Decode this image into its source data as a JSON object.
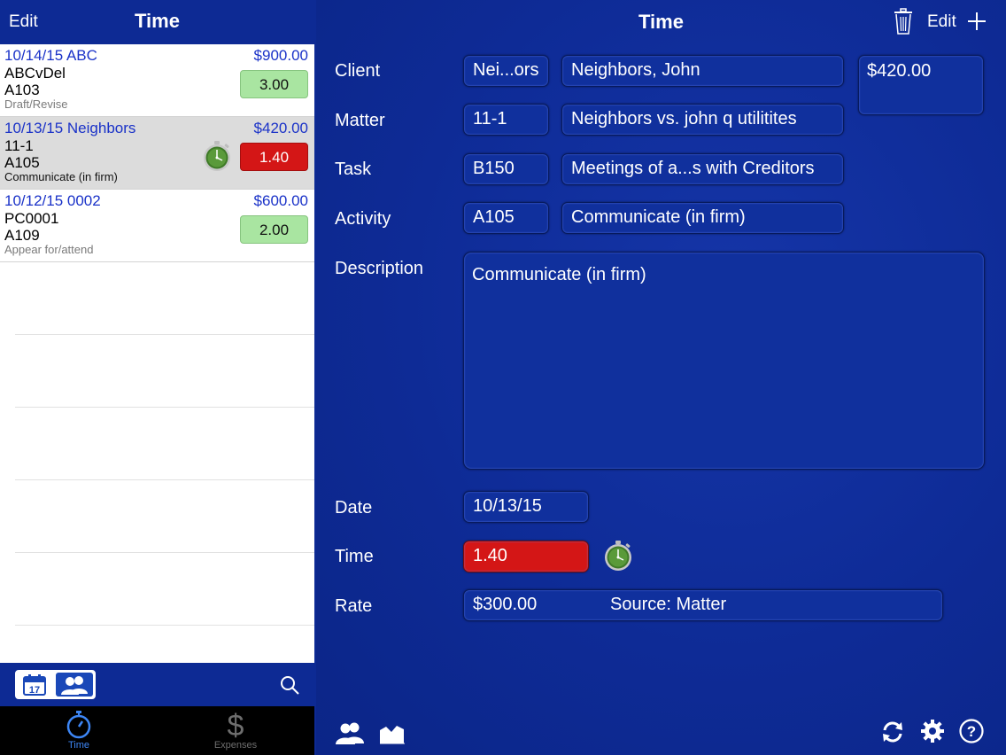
{
  "left": {
    "nav": {
      "edit": "Edit",
      "title": "Time"
    },
    "entries": [
      {
        "date_client": "10/14/15  ABC",
        "amount": "$900.00",
        "matter": "ABCvDel",
        "code": "A103",
        "activity": "Draft/Revise",
        "hours": "3.00",
        "status": "green",
        "selected": false,
        "timer": false
      },
      {
        "date_client": "10/13/15  Neighbors",
        "amount": "$420.00",
        "matter": "11-1",
        "code": "A105",
        "activity": "Communicate (in firm)",
        "hours": "1.40",
        "status": "red",
        "selected": true,
        "timer": true
      },
      {
        "date_client": "10/12/15  0002",
        "amount": "$600.00",
        "matter": "PC0001",
        "code": "A109",
        "activity": "Appear for/attend",
        "hours": "2.00",
        "status": "green",
        "selected": false,
        "timer": false
      }
    ],
    "toolbar": {
      "calendar_day": "17"
    },
    "tabs": [
      {
        "label": "Time",
        "icon": "stopwatch-icon",
        "active": true
      },
      {
        "label": "Expenses",
        "icon": "dollar-icon",
        "active": false
      }
    ]
  },
  "right": {
    "nav": {
      "title": "Time",
      "edit": "Edit"
    },
    "labels": {
      "client": "Client",
      "matter": "Matter",
      "task": "Task",
      "activity": "Activity",
      "description": "Description",
      "date": "Date",
      "time": "Time",
      "rate": "Rate"
    },
    "fields": {
      "client_code": "Nei...ors",
      "client_name": "Neighbors, John",
      "client_amount": "$420.00",
      "matter_code": "11-1",
      "matter_name": "Neighbors vs. john q utilitites",
      "task_code": "B150",
      "task_name": "Meetings of a...s with Creditors",
      "activity_code": "A105",
      "activity_name": "Communicate (in firm)",
      "description": "Communicate (in firm)",
      "date": "10/13/15",
      "time": "1.40",
      "rate": "$300.00",
      "rate_source": "Source: Matter"
    }
  },
  "colors": {
    "nav_blue": "#0d2a94",
    "accent_blue": "#1a32c8",
    "timer_red": "#d41616",
    "hours_green": "#a9e5a1",
    "tab_active": "#3d86f5"
  }
}
